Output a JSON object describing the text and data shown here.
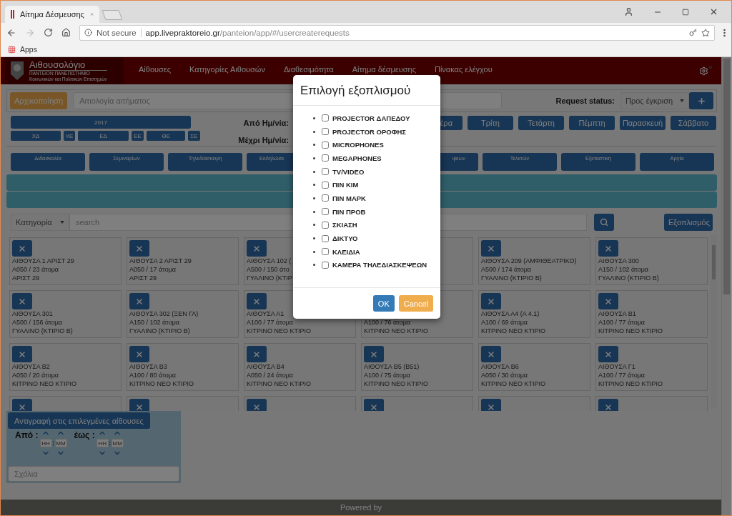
{
  "browser": {
    "tab_title": "Αίτημα Δέσμευσης",
    "security": "Not secure",
    "host": "app.livepraktoreio.gr",
    "path": "/panteion/app/#/usercreaterequests",
    "bookmarks": [
      "Apps"
    ]
  },
  "navbar": {
    "title": "Αιθουσολόγιο",
    "subtitle_1": "ΠΑΝΤΕΙΟΝ ΠΑΝΕΠΙΣΤΗΜΙΟ",
    "subtitle_2": "Κοινωνικών και Πολιτικών Επιστημών",
    "items": [
      "Αίθουσες",
      "Κατηγορίες Αιθουσών",
      "Διαθεσιμότητα",
      "Αίτημα δέσμευσης",
      "Πίνακας ελέγχου"
    ]
  },
  "toolbar": {
    "reset_button": "Αρχικοποίηση",
    "reason_placeholder": "Αιτιολογία αιτήματος",
    "status_label": "Request status:",
    "status_value": "Προς έγκριση"
  },
  "calendar": {
    "year": "2017",
    "months": [
      "ΧΔ",
      "ΧΕ",
      "ΕΔ",
      "ΕΕ",
      "ΘΕ",
      "ΣΕ"
    ],
    "from_label": "Από Ημ/νία:",
    "to_label": "Μέχρι Ημ/νία:",
    "days": [
      "έρα",
      "Τρίτη",
      "Τετάρτη",
      "Πέμπτη",
      "Παρασκευή",
      "Σάββατο"
    ]
  },
  "categories": [
    "Διδασκαλία",
    "Σεμιναρίων",
    "Τηλεδιάσκεψη",
    "Εκδηλώσε",
    "ψεων",
    "Τελετών",
    "Εξεταστική",
    "Αργία"
  ],
  "filters": {
    "category": "Κατηγορία",
    "search_placeholder": "search",
    "equipment_button": "Εξοπλισμός"
  },
  "rooms": [
    [
      {
        "kind": "room",
        "name": "ΑΙΘΟΥΣΑ 1 ΑΡΙΣΤ 29",
        "capacity": "Α050 / 23 άτομα",
        "building": "ΑΡΙΣΤ 29"
      },
      {
        "kind": "room",
        "name": "ΑΙΘΟΥΣΑ 2 ΑΡΙΣΤ 29",
        "capacity": "Α050 / 17 άτομα",
        "building": "ΑΡΙΣΤ 29"
      },
      {
        "kind": "room",
        "name": "ΑΙΘΟΥΣΑ 102 (",
        "capacity": "Α500 / 150 άτο",
        "building": "ΓΥΑΛΙΝΟ (ΚΤΙΡ"
      },
      {
        "kind": "covered"
      },
      {
        "kind": "room",
        "name": "ΑΙΘΟΥΣΑ 209 (ΑΜΦΙΘΕΑΤΡΙΚΟ)",
        "capacity": "Α500 / 174 άτομα",
        "building": "ΓΥΑΛΙΝΟ (ΚΤΙΡΙΟ Β)"
      },
      {
        "kind": "room",
        "name": "ΑΙΘΟΥΣΑ 300",
        "capacity": "Α150 / 102 άτομα",
        "building": "ΓΥΑΛΙΝΟ (ΚΤΙΡΙΟ Β)"
      }
    ],
    [
      {
        "kind": "room",
        "name": "ΑΙΘΟΥΣΑ 301",
        "capacity": "Α500 / 156 άτομα",
        "building": "ΓΥΑΛΙΝΟ (ΚΤΙΡΙΟ Β)"
      },
      {
        "kind": "room",
        "name": "ΑΙΘΟΥΣΑ 302 (ΞΕΝ ΓΛ)",
        "capacity": "Α150 / 102 άτομα",
        "building": "ΓΥΑΛΙΝΟ (ΚΤΙΡΙΟ Β)"
      },
      {
        "kind": "room",
        "name": "ΑΙΘΟΥΣΑ Α1",
        "capacity": "Α100 / 77 άτομα",
        "building": "ΚΙΤΡΙΝΟ ΝΕΟ ΚΤΙΡΙΟ"
      },
      {
        "kind": "covered",
        "capacity": "Α100 / 76 άτομα",
        "building": "ΚΙΤΡΙΝΟ ΝΕΟ ΚΤΙΡΙΟ"
      },
      {
        "kind": "room",
        "name": "ΑΙΘΟΥΣΑ Α4 (Α 4.1)",
        "capacity": "Α100 / 69 άτομα",
        "building": "ΚΙΤΡΙΝΟ ΝΕΟ ΚΤΙΡΙΟ"
      },
      {
        "kind": "room",
        "name": "ΑΙΘΟΥΣΑ Β1",
        "capacity": "Α100 / 77 άτομα",
        "building": "ΚΙΤΡΙΝΟ ΝΕΟ ΚΤΙΡΙΟ"
      }
    ],
    [
      {
        "kind": "room",
        "name": "ΑΙΘΟΥΣΑ Β2",
        "capacity": "Α050 / 20 άτομα",
        "building": "ΚΙΤΡΙΝΟ ΝΕΟ ΚΤΙΡΙΟ"
      },
      {
        "kind": "room",
        "name": "ΑΙΘΟΥΣΑ Β3",
        "capacity": "Α100 / 80 άτομα",
        "building": "ΚΙΤΡΙΝΟ ΝΕΟ ΚΤΙΡΙΟ"
      },
      {
        "kind": "room",
        "name": "ΑΙΘΟΥΣΑ Β4",
        "capacity": "Α050 / 24 άτομα",
        "building": "ΚΙΤΡΙΝΟ ΝΕΟ ΚΤΙΡΙΟ"
      },
      {
        "kind": "room",
        "name": "ΑΙΘΟΥΣΑ Β5 (Β51)",
        "capacity": "Α100 / 75 άτομα",
        "building": "ΚΙΤΡΙΝΟ ΝΕΟ ΚΤΙΡΙΟ"
      },
      {
        "kind": "room",
        "name": "ΑΙΘΟΥΣΑ Β6",
        "capacity": "Α050 / 30 άτομα",
        "building": "ΚΙΤΡΙΝΟ ΝΕΟ ΚΤΙΡΙΟ"
      },
      {
        "kind": "room",
        "name": "ΑΙΘΟΥΣΑ Γ1",
        "capacity": "Α100 / 77 άτομα",
        "building": "ΚΙΤΡΙΝΟ ΝΕΟ ΚΤΙΡΙΟ"
      }
    ],
    [
      {
        "kind": "stub"
      },
      {
        "kind": "stub"
      },
      {
        "kind": "stub"
      },
      {
        "kind": "stub"
      },
      {
        "kind": "stub"
      },
      {
        "kind": "stub"
      }
    ]
  ],
  "copy_panel": {
    "button": "Αντιγραφή στις επιλεγμένες αίθουσες",
    "from_label": "Από :",
    "to_label": "έως :",
    "from_time": {
      "hour_placeholder": "HH",
      "separator": ":",
      "minute_placeholder": "MM"
    },
    "to_time": {
      "hour_placeholder": "HH",
      "separator": ":",
      "minute_placeholder": "MM"
    },
    "comments_placeholder": "Σχόλια"
  },
  "footer": {
    "text": "Powered by"
  },
  "modal": {
    "title": "Επιλογή εξοπλισμού",
    "items": [
      {
        "label": "PROJECTOR ΔΑΠΕΔΟΥ",
        "checked": false
      },
      {
        "label": "PROJECTOR ΟΡΟΦΗΣ",
        "checked": false
      },
      {
        "label": "MICROPHONES",
        "checked": false
      },
      {
        "label": "MEGAPHONES",
        "checked": false
      },
      {
        "label": "TV/VIDEO",
        "checked": false
      },
      {
        "label": "ΠΙΝ ΚΙΜ",
        "checked": false
      },
      {
        "label": "ΠΙΝ ΜΑΡΚ",
        "checked": false
      },
      {
        "label": "ΠΙΝ ΠΡΟΒ",
        "checked": false
      },
      {
        "label": "ΣΚΙΑΣΗ",
        "checked": false
      },
      {
        "label": "ΔΙΚΤΥΟ",
        "checked": false
      },
      {
        "label": "ΚΛΕΙΔΙΑ",
        "checked": false
      },
      {
        "label": "ΚΑΜΕΡΑ ΤΗΛΕΔΙΑΣΚΕΨΕΩΝ",
        "checked": false
      }
    ],
    "ok": "OK",
    "cancel": "Cancel"
  }
}
